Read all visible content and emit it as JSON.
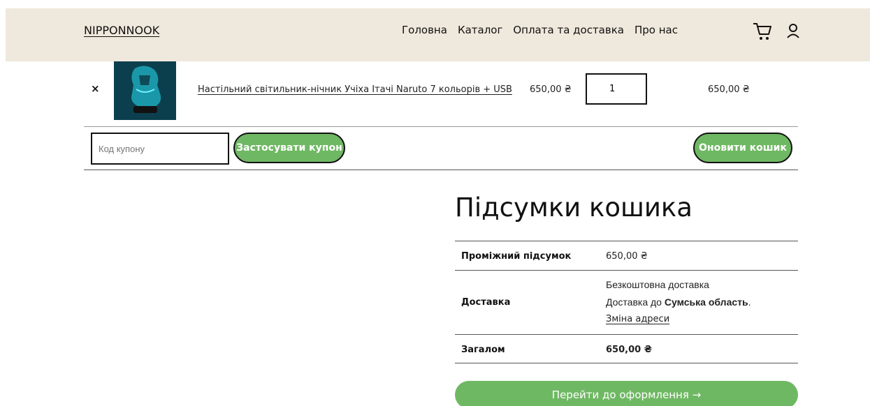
{
  "header": {
    "logo": "NIPPONNOOK",
    "nav": [
      "Головна",
      "Каталог",
      "Оплата та доставка",
      "Про нас"
    ],
    "icons": [
      "cart-icon",
      "user-icon"
    ]
  },
  "cart_item": {
    "remove_symbol": "×",
    "product_name": "Настільний світильник-нічник Учіха Ітачі Naruto 7 кольорів + USB",
    "price": "650,00 ₴",
    "quantity": "1",
    "subtotal": "650,00 ₴"
  },
  "coupon": {
    "placeholder": "Код купону",
    "apply_label": "Застосувати купон",
    "update_label": "Оновити кошик"
  },
  "totals": {
    "title": "Підсумки кошика",
    "subtotal_label": "Проміжний підсумок",
    "subtotal_value": "650,00 ₴",
    "shipping_label": "Доставка",
    "shipping_method": "Безкоштовна доставка",
    "shipping_dest_prefix": "Доставка до",
    "shipping_dest_region": "Сумська область",
    "shipping_dest_suffix": ".",
    "change_address": "Зміна адреси",
    "total_label": "Загалом",
    "total_value": "650,00 ₴"
  },
  "checkout": {
    "label": "Перейти до оформлення →"
  },
  "colors": {
    "header_bg": "#efe8dc",
    "accent_green": "#6fb863"
  }
}
